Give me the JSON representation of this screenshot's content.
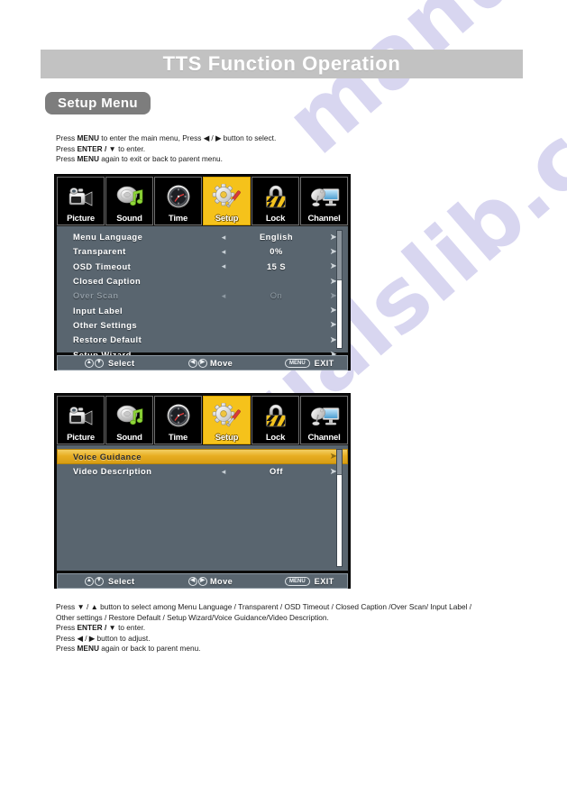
{
  "header": {
    "title": "TTS Function Operation"
  },
  "section": {
    "pill_label": "Setup Menu"
  },
  "instructions_top": [
    {
      "parts": [
        {
          "t": "Press ",
          "b": false
        },
        {
          "t": "MENU",
          "b": true
        },
        {
          "t": " to enter the main menu, Press ◀ / ▶ button to select.",
          "b": false
        }
      ]
    },
    {
      "parts": [
        {
          "t": "Press ",
          "b": false
        },
        {
          "t": "ENTER / ▼",
          "b": true
        },
        {
          "t": " to enter.",
          "b": false
        }
      ]
    },
    {
      "parts": [
        {
          "t": "Press ",
          "b": false
        },
        {
          "t": "MENU",
          "b": true
        },
        {
          "t": " again to exit or back to parent menu.",
          "b": false
        }
      ]
    }
  ],
  "instructions_bottom": [
    {
      "parts": [
        {
          "t": "Press ▼ / ▲  button to select among Menu Language / Transparent / OSD Timeout / Closed Caption /Over Scan/ Input Label /",
          "b": false
        }
      ]
    },
    {
      "parts": [
        {
          "t": "Other settings / Restore Default / Setup Wizard/Voice Guidance/Video Description.",
          "b": false
        }
      ]
    },
    {
      "parts": [
        {
          "t": "Press ",
          "b": false
        },
        {
          "t": "ENTER / ▼",
          "b": true
        },
        {
          "t": " to enter.",
          "b": false
        }
      ]
    },
    {
      "parts": [
        {
          "t": "Press ◀ / ▶ button to adjust.",
          "b": false
        }
      ]
    },
    {
      "parts": [
        {
          "t": "Press ",
          "b": false
        },
        {
          "t": "MENU",
          "b": true
        },
        {
          "t": " again or back to parent menu.",
          "b": false
        }
      ]
    }
  ],
  "osd_tabs": [
    {
      "label": "Picture",
      "icon": "camcorder-icon",
      "selected": false
    },
    {
      "label": "Sound",
      "icon": "speaker-music-note-icon",
      "selected": false
    },
    {
      "label": "Time",
      "icon": "clock-icon",
      "selected": false
    },
    {
      "label": "Setup",
      "icon": "gear-screwdriver-icon",
      "selected": true
    },
    {
      "label": "Lock",
      "icon": "padlock-icon",
      "selected": false
    },
    {
      "label": "Channel",
      "icon": "satellite-monitor-icon",
      "selected": false
    }
  ],
  "osd_menu_1": {
    "rows": [
      {
        "label": "Menu Language",
        "value": "English",
        "left_arrow": "◂",
        "right_arrow": "➤",
        "dim": false,
        "highlighted": false
      },
      {
        "label": "Transparent",
        "value": "0%",
        "left_arrow": "◂",
        "right_arrow": "➤",
        "dim": false,
        "highlighted": false
      },
      {
        "label": "OSD Timeout",
        "value": "15 S",
        "left_arrow": "◂",
        "right_arrow": "➤",
        "dim": false,
        "highlighted": false
      },
      {
        "label": "Closed Caption",
        "value": "",
        "left_arrow": "",
        "right_arrow": "➤",
        "dim": false,
        "highlighted": false
      },
      {
        "label": "Over Scan",
        "value": "On",
        "left_arrow": "◂",
        "right_arrow": "➤",
        "dim": true,
        "highlighted": false
      },
      {
        "label": "Input Label",
        "value": "",
        "left_arrow": "",
        "right_arrow": "➤",
        "dim": false,
        "highlighted": false
      },
      {
        "label": "Other Settings",
        "value": "",
        "left_arrow": "",
        "right_arrow": "➤",
        "dim": false,
        "highlighted": false
      },
      {
        "label": "Restore Default",
        "value": "",
        "left_arrow": "",
        "right_arrow": "➤",
        "dim": false,
        "highlighted": false
      },
      {
        "label": "Setup Wizard",
        "value": "",
        "left_arrow": "",
        "right_arrow": "➤",
        "dim": false,
        "highlighted": false
      }
    ]
  },
  "osd_menu_2": {
    "rows": [
      {
        "label": "Voice Guidance",
        "value": "",
        "left_arrow": "",
        "right_arrow": "➤",
        "dim": false,
        "highlighted": true
      },
      {
        "label": "Video Description",
        "value": "Off",
        "left_arrow": "◂",
        "right_arrow": "➤",
        "dim": false,
        "highlighted": false
      }
    ]
  },
  "osd_footer": {
    "select_keys": [
      "▲",
      "▼"
    ],
    "select_label": "Select",
    "move_keys": [
      "◀",
      "▶"
    ],
    "move_label": "Move",
    "exit_key": "MENU",
    "exit_label": "EXIT"
  },
  "watermark": {
    "line_a": "manualslib.com",
    "line_b": "manualslib.com"
  },
  "colors": {
    "banner_bg": "#c2c2c2",
    "pill_bg": "#7d7d7d",
    "osd_list_bg": "#59656f",
    "tab_selected_bg": "#f5c21b",
    "highlight_row": "#e8ae22",
    "dim_text": "#8e99a2"
  }
}
